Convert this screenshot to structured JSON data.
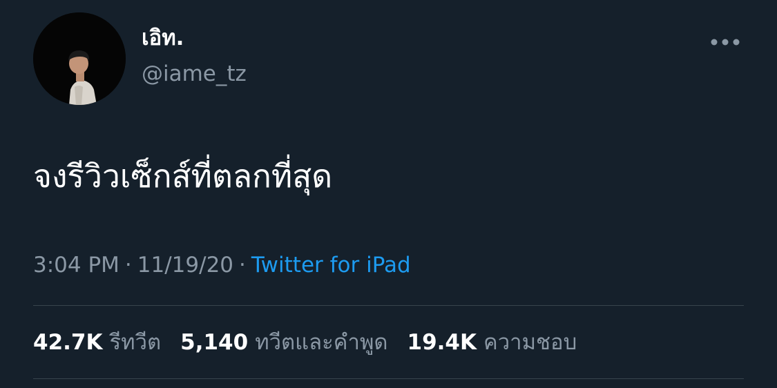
{
  "user": {
    "display_name": "เอิท.",
    "handle": "@iame_tz"
  },
  "tweet": {
    "text": "จงรีวิวเซ็กส์ที่ตลกที่สุด"
  },
  "meta": {
    "time": "3:04 PM",
    "date": "11/19/20",
    "separator": "·",
    "source": "Twitter for iPad"
  },
  "stats": {
    "retweets_count": "42.7K",
    "retweets_label": "รีทวีต",
    "quotes_count": "5,140",
    "quotes_label": "ทวีตและคำพูด",
    "likes_count": "19.4K",
    "likes_label": "ความชอบ"
  },
  "colors": {
    "background": "#15202b",
    "primary_text": "#ffffff",
    "secondary_text": "#8b98a5",
    "link": "#1d9bf0",
    "divider": "#38444d"
  },
  "icons": {
    "more": "more-horizontal-icon",
    "avatar": "user-avatar-photo"
  }
}
